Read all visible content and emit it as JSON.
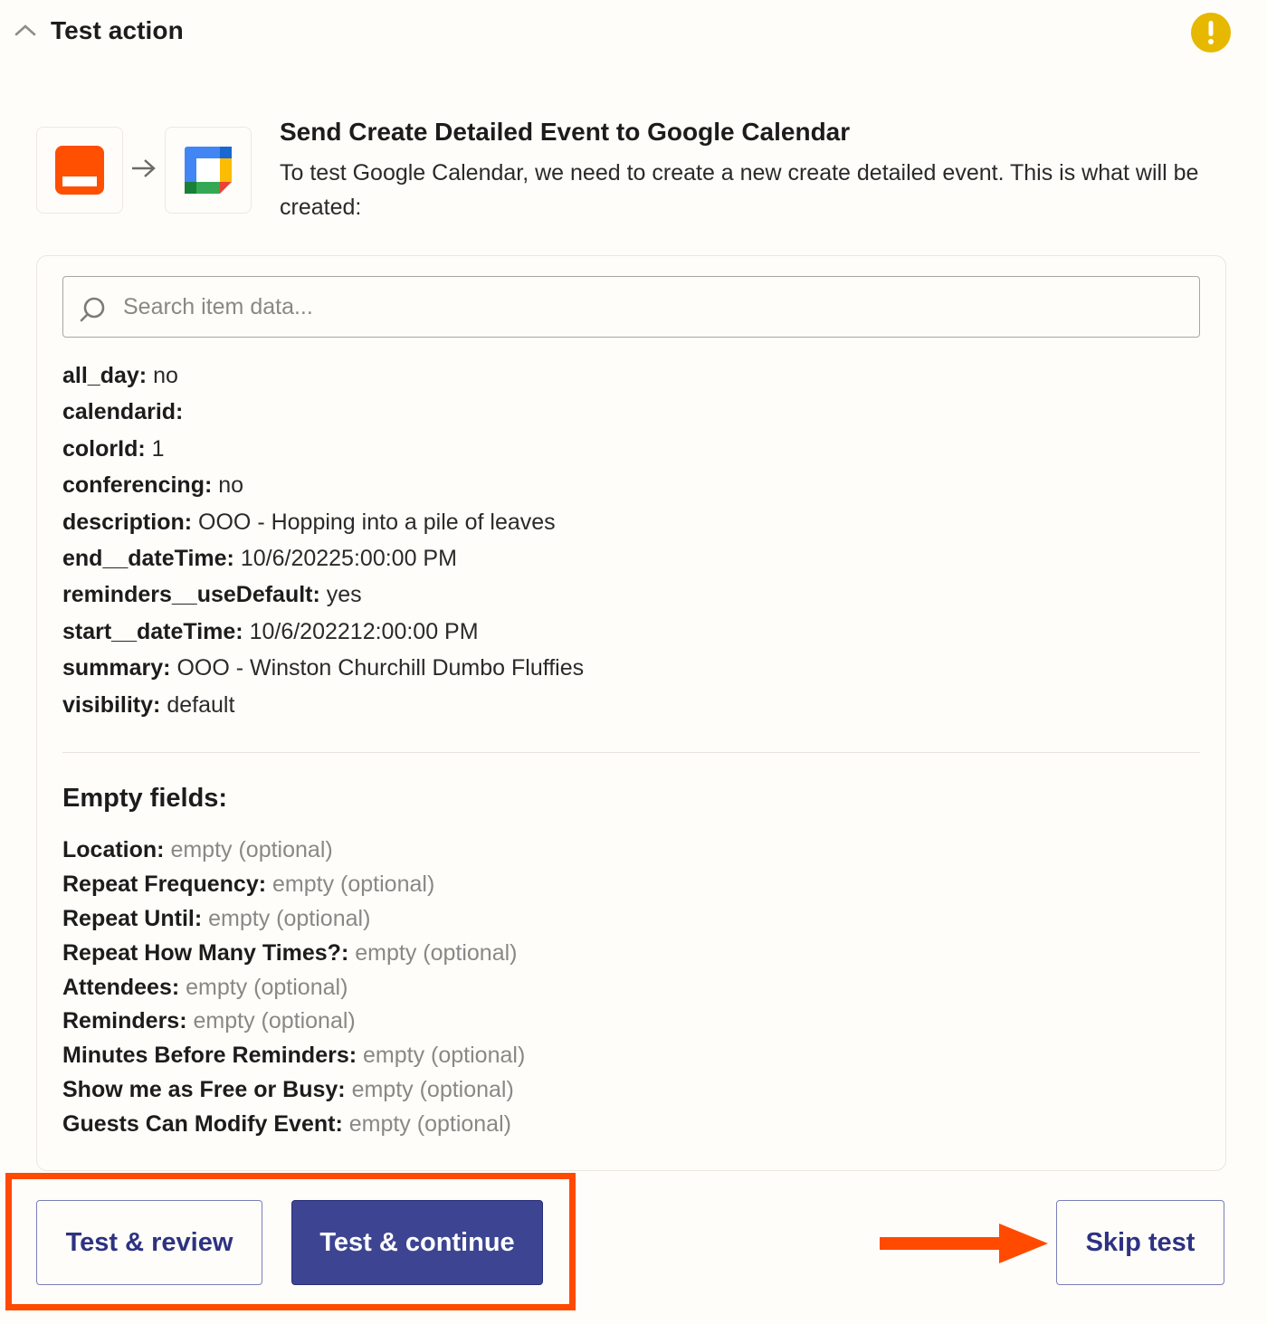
{
  "header": {
    "title": "Test action",
    "collapse_icon": "chevron-up-icon",
    "status_icon": "warning-icon",
    "status_color": "#e6b800"
  },
  "intro": {
    "source_app_icon": "orange-app-icon",
    "target_app_icon": "google-calendar-icon",
    "flow_icon": "arrow-right-icon",
    "title": "Send Create Detailed Event to Google Calendar",
    "description": "To test Google Calendar, we need to create a new create detailed event. This is what will be created:"
  },
  "search": {
    "placeholder": "Search item data...",
    "value": ""
  },
  "fields": [
    {
      "key": "all_day:",
      "value": "no"
    },
    {
      "key": "calendarid:",
      "value": ""
    },
    {
      "key": "colorId:",
      "value": "1"
    },
    {
      "key": "conferencing:",
      "value": "no"
    },
    {
      "key": "description:",
      "value": "OOO - Hopping into a pile of leaves"
    },
    {
      "key": "end__dateTime:",
      "value": "10/6/20225:00:00 PM"
    },
    {
      "key": "reminders__useDefault:",
      "value": "yes"
    },
    {
      "key": "start__dateTime:",
      "value": "10/6/202212:00:00 PM"
    },
    {
      "key": "summary:",
      "value": "OOO - Winston Churchill Dumbo Fluffies"
    },
    {
      "key": "visibility:",
      "value": "default"
    }
  ],
  "empty_section": {
    "title": "Empty fields:",
    "items": [
      {
        "key": "Location:",
        "value": "empty (optional)"
      },
      {
        "key": "Repeat Frequency:",
        "value": "empty (optional)"
      },
      {
        "key": "Repeat Until:",
        "value": "empty (optional)"
      },
      {
        "key": "Repeat How Many Times?:",
        "value": "empty (optional)"
      },
      {
        "key": "Attendees:",
        "value": "empty (optional)"
      },
      {
        "key": "Reminders:",
        "value": "empty (optional)"
      },
      {
        "key": "Minutes Before Reminders:",
        "value": "empty (optional)"
      },
      {
        "key": "Show me as Free or Busy:",
        "value": "empty (optional)"
      },
      {
        "key": "Guests Can Modify Event:",
        "value": "empty (optional)"
      }
    ]
  },
  "actions": {
    "test_review_label": "Test & review",
    "test_continue_label": "Test & continue",
    "skip_label": "Skip test"
  },
  "colors": {
    "annotation": "#ff4a00",
    "primary": "#3d4592",
    "primary_text": "#2d3282"
  }
}
